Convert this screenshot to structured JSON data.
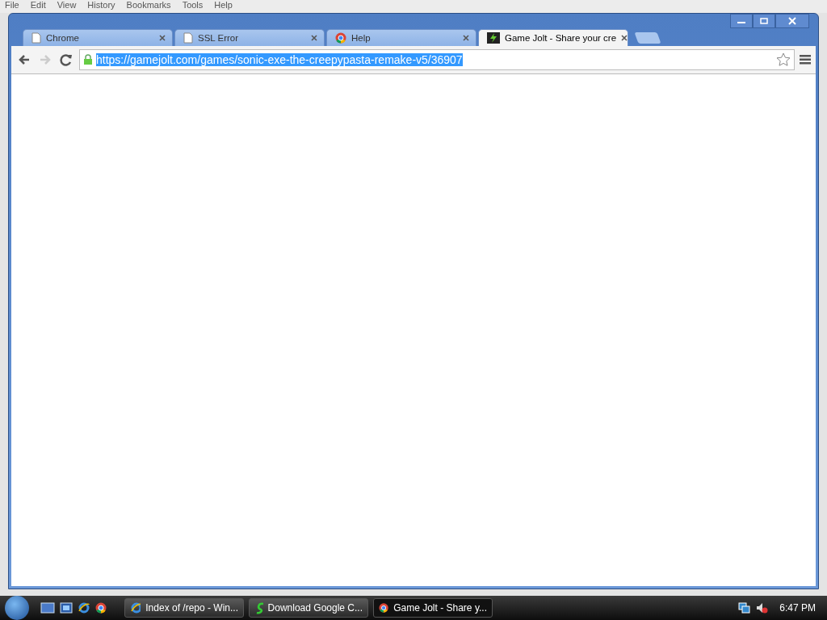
{
  "background_window": {
    "menu": [
      "File",
      "Edit",
      "View",
      "History",
      "Bookmarks",
      "Tools",
      "Help"
    ]
  },
  "browser": {
    "tabs": [
      {
        "title": "Chrome",
        "selected": false
      },
      {
        "title": "SSL Error",
        "selected": false
      },
      {
        "title": "Help",
        "selected": false
      },
      {
        "title": "Game Jolt - Share your cre",
        "selected": true
      }
    ],
    "address": {
      "url": "https://gamejolt.com/games/sonic-exe-the-creepypasta-remake-v5/36907",
      "secure": true,
      "selected": true
    },
    "forward_disabled": true
  },
  "taskbar": {
    "buttons": [
      {
        "label": "Index of /repo - Win...",
        "selected": false
      },
      {
        "label": "Download Google C...",
        "selected": false
      },
      {
        "label": "Game Jolt - Share y...",
        "selected": true
      }
    ],
    "clock": "6:47 PM"
  }
}
